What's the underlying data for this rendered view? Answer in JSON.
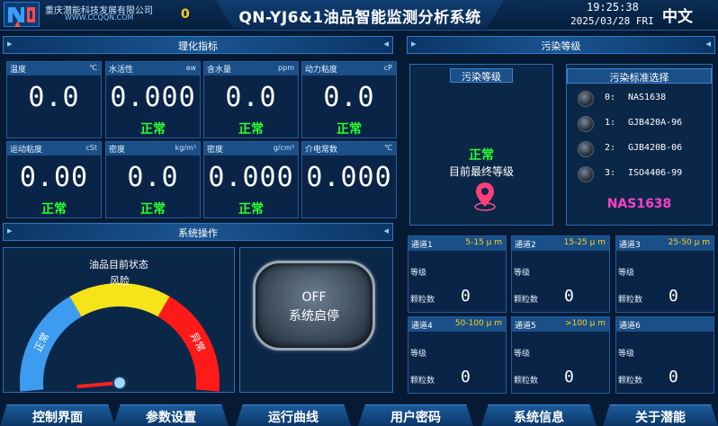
{
  "header": {
    "company": "重庆潜能科技发展有限公司",
    "site": "WWW.CCQQN.COM",
    "alarm_count": "0",
    "title": "QN-YJ6&1油品智能监测分析系统",
    "time": "19:25:38",
    "date": "2025/03/28 FRI",
    "language": "中文"
  },
  "sections": {
    "physchem": "理化指标",
    "system_op": "系统操作",
    "pollution": "污染等级"
  },
  "metrics": [
    {
      "name": "温度",
      "unit": "℃",
      "value": "0.0",
      "status": ""
    },
    {
      "name": "水活性",
      "unit": "aw",
      "value": "0.000",
      "status": "正常"
    },
    {
      "name": "含水量",
      "unit": "ppm",
      "value": "0.0",
      "status": "正常"
    },
    {
      "name": "动力粘度",
      "unit": "cP",
      "value": "0.0",
      "status": "正常"
    },
    {
      "name": "运动粘度",
      "unit": "cSt",
      "value": "0.00",
      "status": "正常"
    },
    {
      "name": "密度",
      "unit": "kg/m³",
      "value": "0.0",
      "status": "正常"
    },
    {
      "name": "密度",
      "unit": "g/cm³",
      "value": "0.000",
      "status": "正常"
    },
    {
      "name": "介电常数",
      "unit": "℃",
      "value": "0.000",
      "status": ""
    }
  ],
  "gauge": {
    "title": "油品目前状态",
    "labels": [
      "正常",
      "风险",
      "异常"
    ],
    "colors": [
      "#3d9cf0",
      "#f4e419",
      "#ff1a1a"
    ],
    "value": 0
  },
  "start_button": {
    "state": "OFF",
    "label": "系统启停"
  },
  "pollution_panel": {
    "title": "污染等级",
    "status": "正常",
    "final_label": "目前最终等级"
  },
  "standard_panel": {
    "title": "污染标准选择",
    "options": [
      {
        "idx": "0:",
        "name": "NAS1638"
      },
      {
        "idx": "1:",
        "name": "GJB420A-96"
      },
      {
        "idx": "2:",
        "name": "GJB420B-06"
      },
      {
        "idx": "3:",
        "name": "ISO4406-99"
      }
    ],
    "selected": "NAS1638",
    "selected_color": "#ff3fc8"
  },
  "channels": [
    {
      "name": "通道1",
      "range": "5-15 μ m",
      "level_label": "等级",
      "count_label": "颗粒数",
      "count": "0"
    },
    {
      "name": "通道2",
      "range": "15-25 μ m",
      "level_label": "等级",
      "count_label": "颗粒数",
      "count": "0"
    },
    {
      "name": "通道3",
      "range": "25-50 μ m",
      "level_label": "等级",
      "count_label": "颗粒数",
      "count": "0"
    },
    {
      "name": "通道4",
      "range": "50-100 μ m",
      "level_label": "等级",
      "count_label": "颗粒数",
      "count": "0"
    },
    {
      "name": "通道5",
      "range": ">100 μ m",
      "level_label": "等级",
      "count_label": "颗粒数",
      "count": "0"
    },
    {
      "name": "通道6",
      "range": "",
      "level_label": "等级",
      "count_label": "颗粒数",
      "count": "0"
    }
  ],
  "nav": [
    "控制界面",
    "参数设置",
    "运行曲线",
    "用户密码",
    "系统信息",
    "关于潜能"
  ]
}
